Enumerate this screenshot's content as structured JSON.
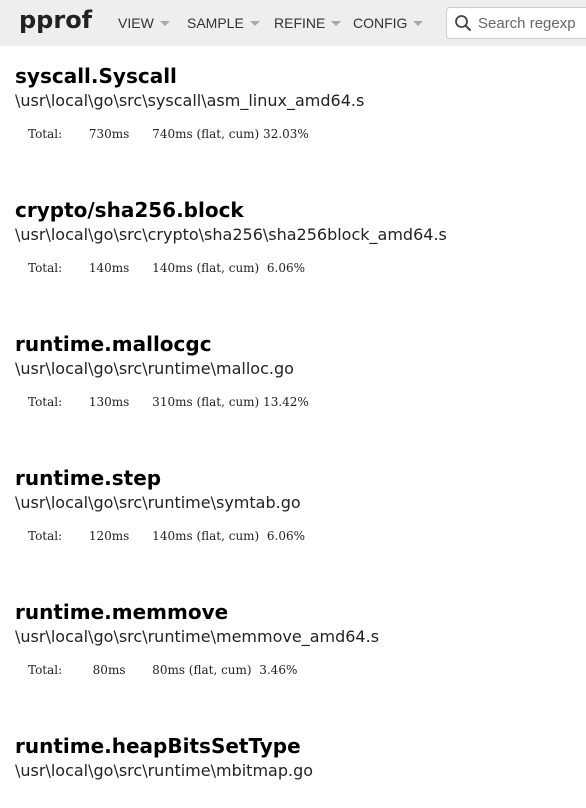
{
  "header": {
    "logo": "pprof",
    "menus": [
      "VIEW",
      "SAMPLE",
      "REFINE",
      "CONFIG"
    ],
    "search_placeholder": "Search regexp"
  },
  "functions": [
    {
      "name": "syscall.Syscall",
      "path": "\\usr\\local\\go\\src\\syscall\\asm_linux_amd64.s",
      "total_line": "Total:       730ms      740ms (flat, cum) 32.03%"
    },
    {
      "name": "crypto/sha256.block",
      "path": "\\usr\\local\\go\\src\\crypto\\sha256\\sha256block_amd64.s",
      "total_line": "Total:       140ms      140ms (flat, cum)  6.06%"
    },
    {
      "name": "runtime.mallocgc",
      "path": "\\usr\\local\\go\\src\\runtime\\malloc.go",
      "total_line": "Total:       130ms      310ms (flat, cum) 13.42%"
    },
    {
      "name": "runtime.step",
      "path": "\\usr\\local\\go\\src\\runtime\\symtab.go",
      "total_line": "Total:       120ms      140ms (flat, cum)  6.06%"
    },
    {
      "name": "runtime.memmove",
      "path": "\\usr\\local\\go\\src\\runtime\\memmove_amd64.s",
      "total_line": "Total:        80ms       80ms (flat, cum)  3.46%"
    },
    {
      "name": "runtime.heapBitsSetType",
      "path": "\\usr\\local\\go\\src\\runtime\\mbitmap.go",
      "total_line": ""
    }
  ]
}
